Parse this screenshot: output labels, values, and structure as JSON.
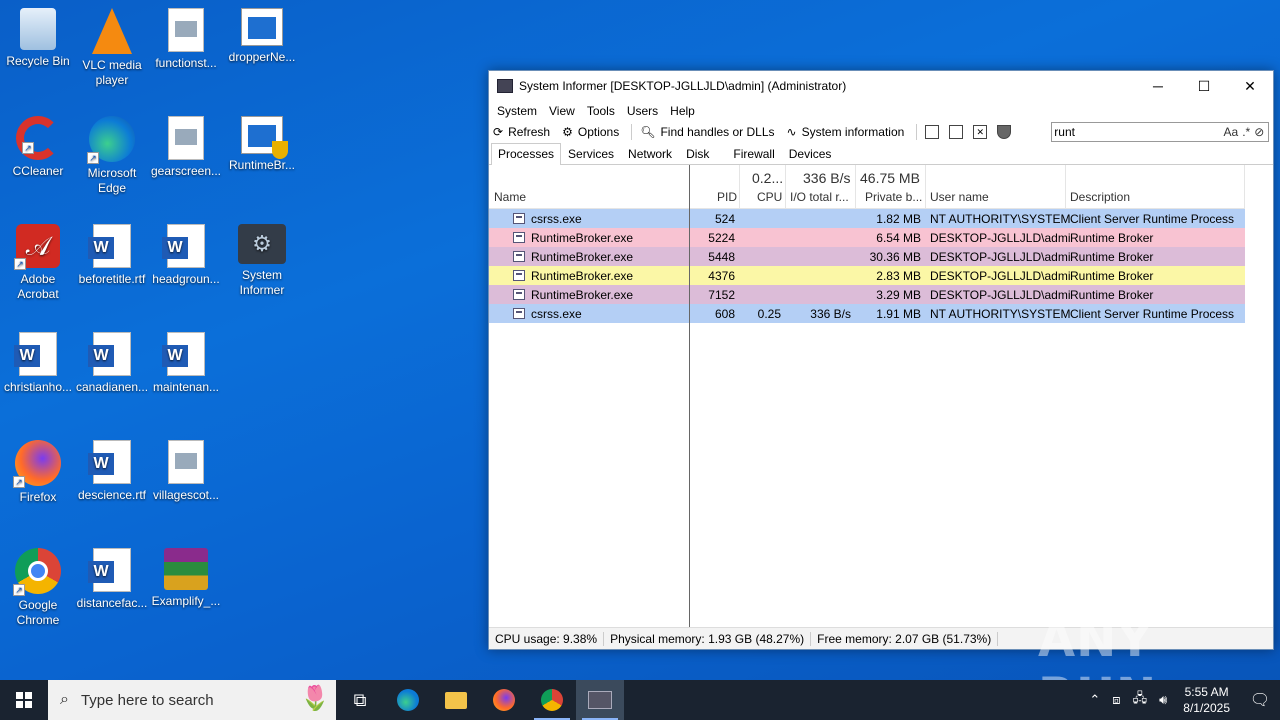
{
  "desktop": {
    "icons": [
      {
        "label": "Recycle Bin"
      },
      {
        "label": "VLC media player"
      },
      {
        "label": "functionst..."
      },
      {
        "label": "dropperNe..."
      },
      {
        "label": "CCleaner"
      },
      {
        "label": "Microsoft Edge"
      },
      {
        "label": "gearscreen..."
      },
      {
        "label": "RuntimeBr..."
      },
      {
        "label": "Adobe Acrobat"
      },
      {
        "label": "beforetitle.rtf"
      },
      {
        "label": "headgroun..."
      },
      {
        "label": "System Informer"
      },
      {
        "label": "christianho..."
      },
      {
        "label": "canadianen..."
      },
      {
        "label": "maintenan..."
      },
      {
        "label": "Firefox"
      },
      {
        "label": "descience.rtf"
      },
      {
        "label": "villagescot..."
      },
      {
        "label": "Google Chrome"
      },
      {
        "label": "distancefac..."
      },
      {
        "label": "Examplify_..."
      }
    ]
  },
  "window": {
    "title": "System Informer [DESKTOP-JGLLJLD\\admin] (Administrator)",
    "menu": [
      "System",
      "View",
      "Tools",
      "Users",
      "Help"
    ],
    "toolbar": {
      "refresh": "Refresh",
      "options": "Options",
      "find_handles": "Find handles or DLLs",
      "system_info": "System information"
    },
    "search": {
      "value": "runt",
      "case_label": "Aa",
      "regex_label": ".*"
    },
    "tabs": [
      "Processes",
      "Services",
      "Network",
      "Disk",
      "Firewall",
      "Devices"
    ],
    "columns": {
      "name": "Name",
      "pid": "PID",
      "cpu": "CPU",
      "io": "I/O total r...",
      "private": "Private b...",
      "user": "User name",
      "desc": "Description"
    },
    "totals": {
      "cpu": "0.2...",
      "io": "336 B/s",
      "private": "46.75 MB"
    },
    "rows": [
      {
        "name": "csrss.exe",
        "pid": "524",
        "cpu": "",
        "io": "",
        "private": "1.82 MB",
        "user": "NT AUTHORITY\\SYSTEM",
        "desc": "Client Server Runtime Process",
        "color": "#b4cff5"
      },
      {
        "name": "RuntimeBroker.exe",
        "pid": "5224",
        "cpu": "",
        "io": "",
        "private": "6.54 MB",
        "user": "DESKTOP-JGLLJLD\\admi",
        "desc": "Runtime Broker",
        "color": "#f8c3d2"
      },
      {
        "name": "RuntimeBroker.exe",
        "pid": "5448",
        "cpu": "",
        "io": "",
        "private": "30.36 MB",
        "user": "DESKTOP-JGLLJLD\\admi",
        "desc": "Runtime Broker",
        "color": "#dcbcd8"
      },
      {
        "name": "RuntimeBroker.exe",
        "pid": "4376",
        "cpu": "",
        "io": "",
        "private": "2.83 MB",
        "user": "DESKTOP-JGLLJLD\\admi",
        "desc": "Runtime Broker",
        "color": "#fbf7a6"
      },
      {
        "name": "RuntimeBroker.exe",
        "pid": "7152",
        "cpu": "",
        "io": "",
        "private": "3.29 MB",
        "user": "DESKTOP-JGLLJLD\\admi",
        "desc": "Runtime Broker",
        "color": "#dcbcd8"
      },
      {
        "name": "csrss.exe",
        "pid": "608",
        "cpu": "0.25",
        "io": "336 B/s",
        "private": "1.91 MB",
        "user": "NT AUTHORITY\\SYSTEM",
        "desc": "Client Server Runtime Process",
        "color": "#b4cff5"
      }
    ],
    "status": {
      "cpu": "CPU usage: 9.38%",
      "phys": "Physical memory: 1.93 GB (48.27%)",
      "free": "Free memory: 2.07 GB (51.73%)"
    }
  },
  "watermark": "ANY RUN",
  "taskbar": {
    "search_placeholder": "Type here to search",
    "time": "5:55 AM",
    "date": "8/1/2025"
  }
}
